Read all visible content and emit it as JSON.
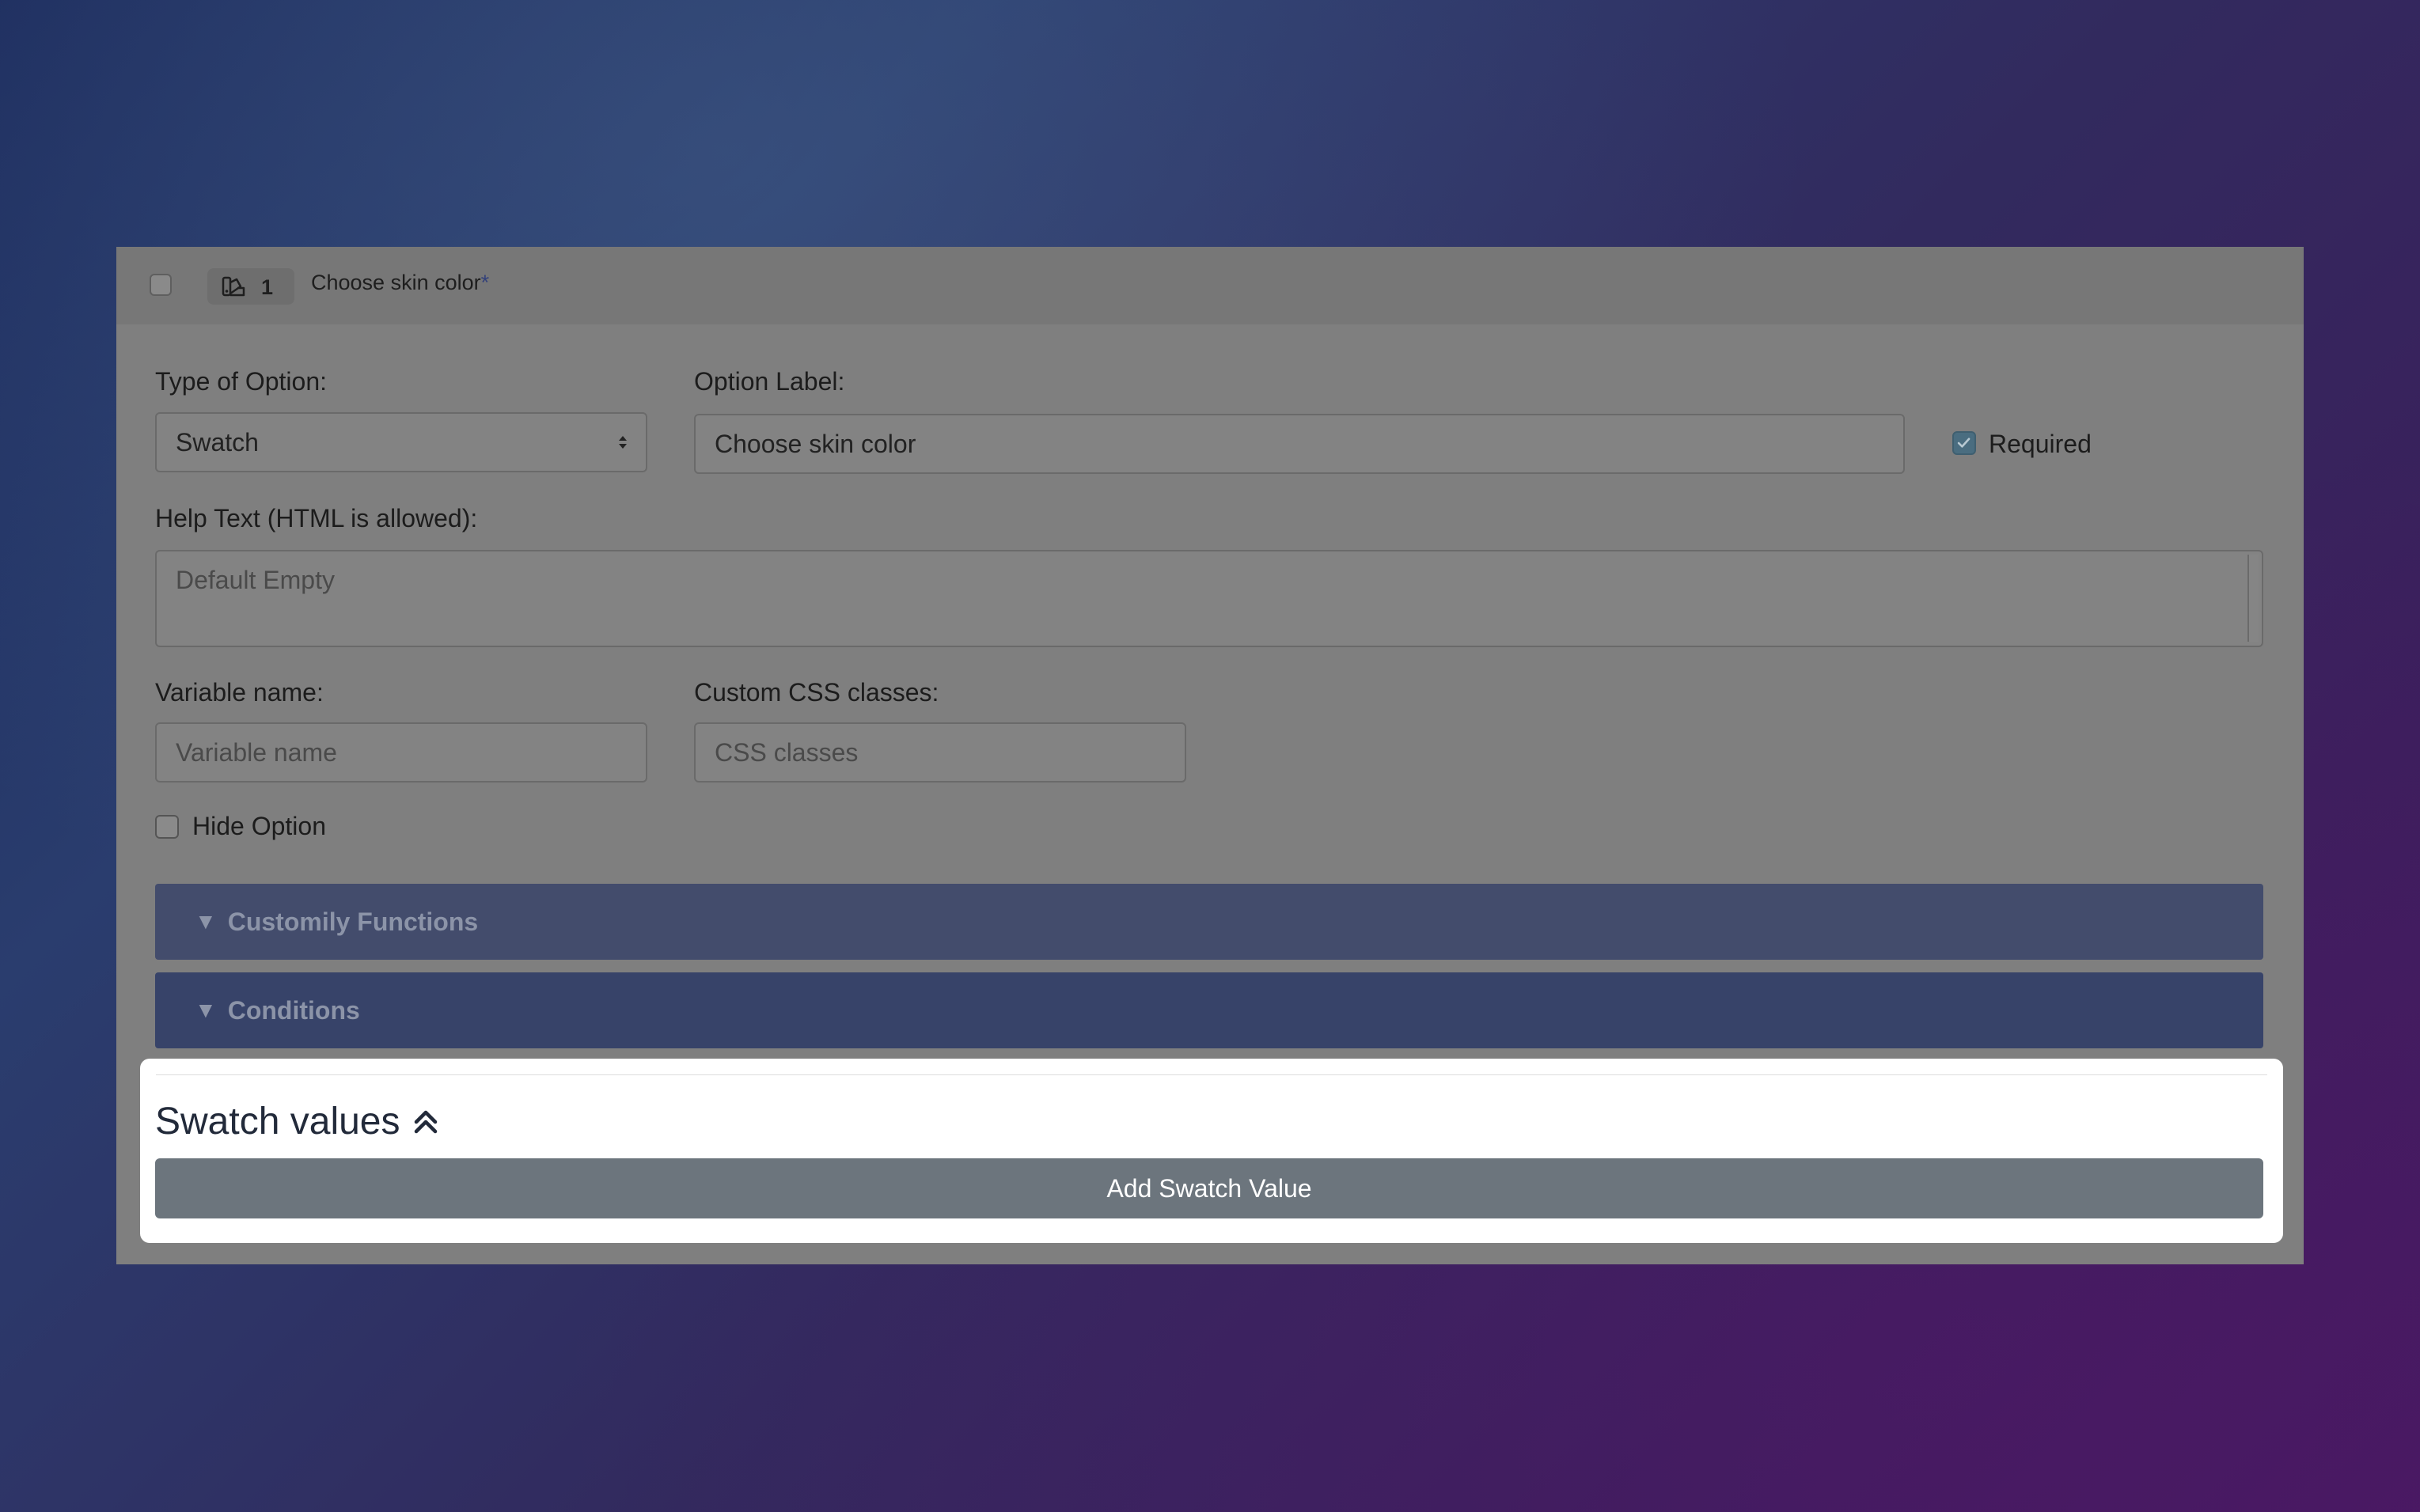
{
  "header": {
    "option_number": "1",
    "title": "Choose skin color",
    "required_mark": "*",
    "icon": "swatch-icon"
  },
  "form": {
    "type_label": "Type of Option:",
    "type_value": "Swatch",
    "option_label_label": "Option Label:",
    "option_label_value": "Choose skin color",
    "required_label": "Required",
    "required_checked": true,
    "help_label": "Help Text (HTML is allowed):",
    "help_placeholder": "Default Empty",
    "variable_label": "Variable name:",
    "variable_placeholder": "Variable name",
    "css_label": "Custom CSS classes:",
    "css_placeholder": "CSS classes",
    "hide_label": "Hide Option",
    "hide_checked": false
  },
  "accordions": {
    "functions": "Customily Functions",
    "conditions": "Conditions",
    "triangle": "▼"
  },
  "swatch": {
    "title": "Swatch values",
    "add_button": "Add Swatch Value",
    "toggle_icon": "double-chevron-up-icon"
  }
}
